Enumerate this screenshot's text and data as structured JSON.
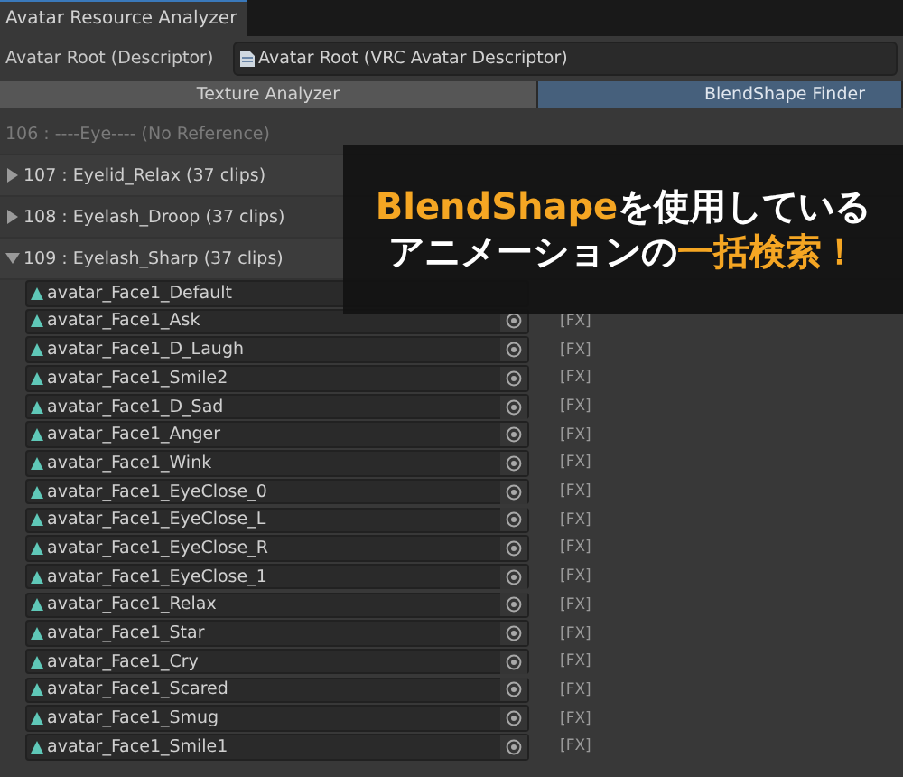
{
  "window": {
    "tab": "Avatar Resource Analyzer"
  },
  "descriptor": {
    "label": "Avatar Root (Descriptor)",
    "value": "Avatar Root (VRC Avatar Descriptor)"
  },
  "toolbar": [
    {
      "label": "Texture Analyzer",
      "selected": false
    },
    {
      "label": "BlendShape Finder",
      "selected": true
    }
  ],
  "groups": [
    {
      "kind": "empty",
      "label": "106 : ----Eye---- (No Reference)"
    },
    {
      "kind": "foldout",
      "label": "107 : Eyelid_Relax (37 clips)",
      "expanded": false
    },
    {
      "kind": "foldout",
      "label": "108 : Eyelash_Droop (37 clips)",
      "expanded": false
    },
    {
      "kind": "foldout",
      "label": "109 : Eyelash_Sharp (37 clips)",
      "expanded": true,
      "clips": [
        {
          "name": "avatar_Face1_Default"
        },
        {
          "name": "avatar_Face1_Ask",
          "layer": "[FX]"
        },
        {
          "name": "avatar_Face1_D_Laugh",
          "layer": "[FX]"
        },
        {
          "name": "avatar_Face1_Smile2",
          "layer": "[FX]"
        },
        {
          "name": "avatar_Face1_D_Sad",
          "layer": "[FX]"
        },
        {
          "name": "avatar_Face1_Anger",
          "layer": "[FX]"
        },
        {
          "name": "avatar_Face1_Wink",
          "layer": "[FX]"
        },
        {
          "name": "avatar_Face1_EyeClose_0",
          "layer": "[FX]"
        },
        {
          "name": "avatar_Face1_EyeClose_L",
          "layer": "[FX]"
        },
        {
          "name": "avatar_Face1_EyeClose_R",
          "layer": "[FX]"
        },
        {
          "name": "avatar_Face1_EyeClose_1",
          "layer": "[FX]"
        },
        {
          "name": "avatar_Face1_Relax",
          "layer": "[FX]"
        },
        {
          "name": "avatar_Face1_Star",
          "layer": "[FX]"
        },
        {
          "name": "avatar_Face1_Cry",
          "layer": "[FX]"
        },
        {
          "name": "avatar_Face1_Scared",
          "layer": "[FX]"
        },
        {
          "name": "avatar_Face1_Smug",
          "layer": "[FX]"
        },
        {
          "name": "avatar_Face1_Smile1",
          "layer": "[FX]"
        }
      ]
    }
  ],
  "banner": {
    "lines": [
      [
        {
          "text": "BlendShape",
          "highlight": true
        },
        {
          "text": "を使用している",
          "highlight": false
        }
      ],
      [
        {
          "text": "アニメーションの",
          "highlight": false
        },
        {
          "text": "一括検索！",
          "highlight": true
        }
      ]
    ]
  }
}
